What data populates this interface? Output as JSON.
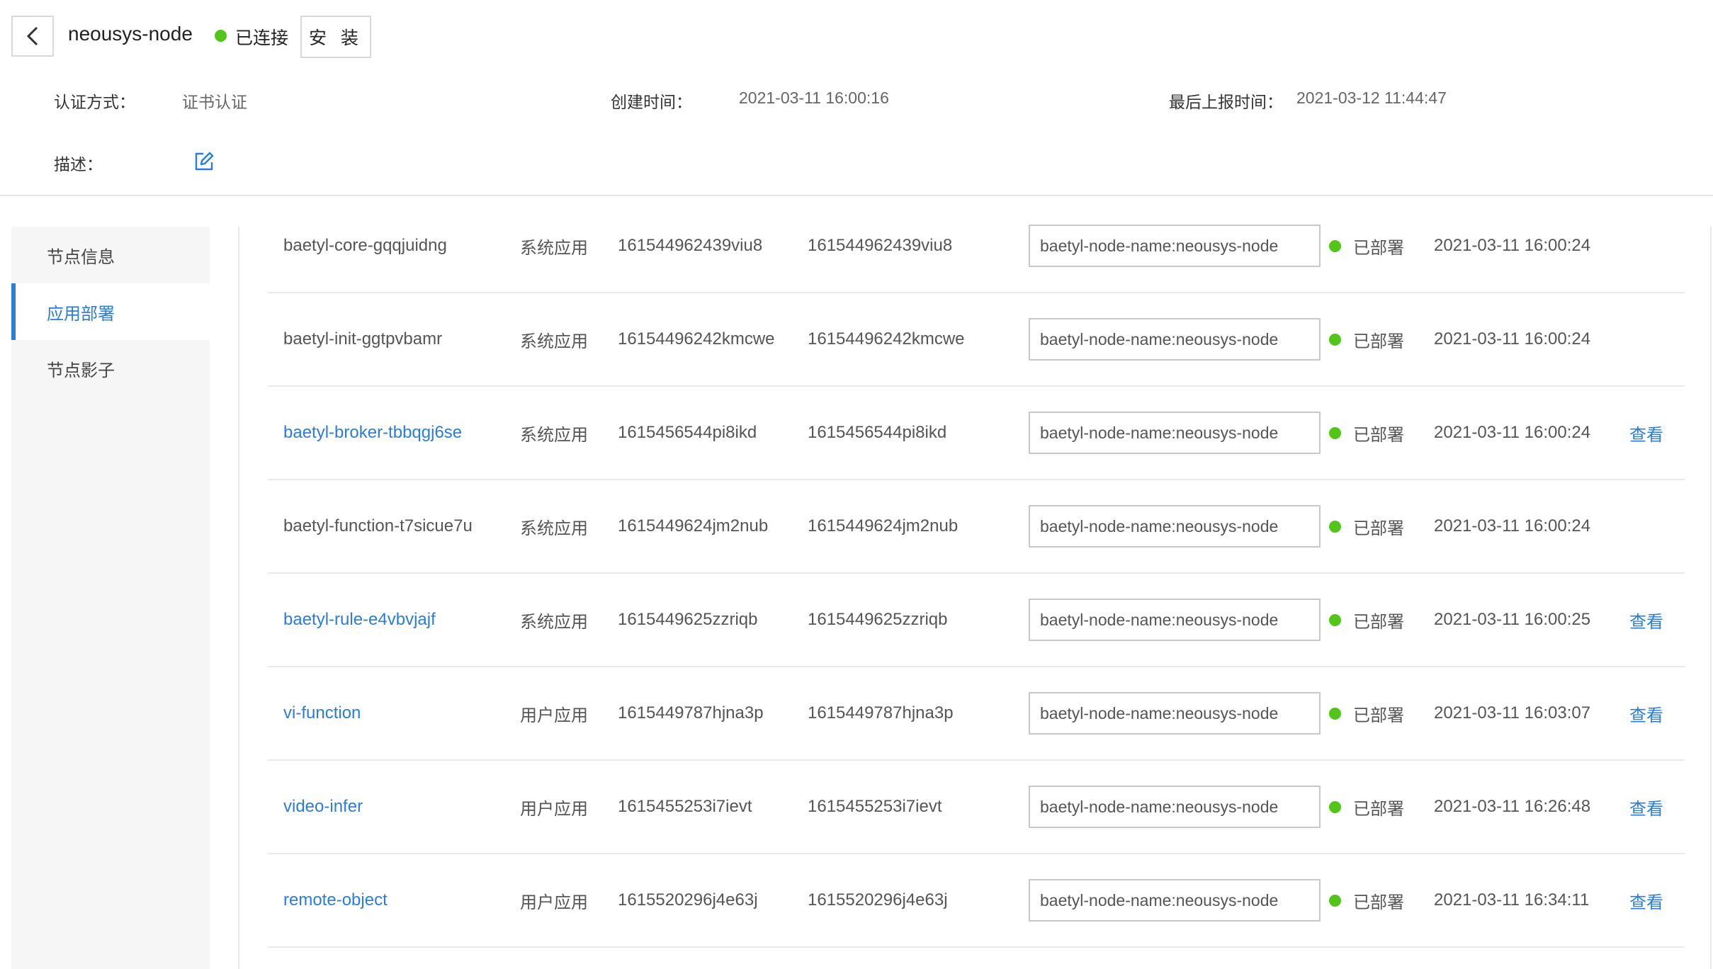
{
  "header": {
    "node_name": "neousys-node",
    "connection_status": "已连接",
    "install_label": "安 装",
    "auth_label": "认证方式：",
    "auth_value": "证书认证",
    "created_label": "创建时间：",
    "created_value": "2021-03-11 16:00:16",
    "report_label": "最后上报时间：",
    "report_value": "2021-03-12 11:44:47",
    "desc_label": "描述："
  },
  "sidebar": {
    "items": [
      {
        "label": "节点信息"
      },
      {
        "label": "应用部署"
      },
      {
        "label": "节点影子"
      }
    ]
  },
  "colors": {
    "accent": "#2a7ddc",
    "status_green": "#52c41a"
  },
  "apps": [
    {
      "name": "baetyl-core-gqqjuidng",
      "type": "系统应用",
      "version": "161544962439viu8",
      "config_version": "161544962439viu8",
      "selector": "baetyl-node-name:neousys-node",
      "status": "已部署",
      "time": "2021-03-11 16:00:24",
      "action": ""
    },
    {
      "name": "baetyl-init-ggtpvbamr",
      "type": "系统应用",
      "version": "16154496242kmcwe",
      "config_version": "16154496242kmcwe",
      "selector": "baetyl-node-name:neousys-node",
      "status": "已部署",
      "time": "2021-03-11 16:00:24",
      "action": ""
    },
    {
      "name": "baetyl-broker-tbbqgj6se",
      "type": "系统应用",
      "version": "1615456544pi8ikd",
      "config_version": "1615456544pi8ikd",
      "selector": "baetyl-node-name:neousys-node",
      "status": "已部署",
      "time": "2021-03-11 16:00:24",
      "action": "查看"
    },
    {
      "name": "baetyl-function-t7sicue7u",
      "type": "系统应用",
      "version": "1615449624jm2nub",
      "config_version": "1615449624jm2nub",
      "selector": "baetyl-node-name:neousys-node",
      "status": "已部署",
      "time": "2021-03-11 16:00:24",
      "action": ""
    },
    {
      "name": "baetyl-rule-e4vbvjajf",
      "type": "系统应用",
      "version": "1615449625zzriqb",
      "config_version": "1615449625zzriqb",
      "selector": "baetyl-node-name:neousys-node",
      "status": "已部署",
      "time": "2021-03-11 16:00:25",
      "action": "查看"
    },
    {
      "name": "vi-function",
      "type": "用户应用",
      "version": "1615449787hjna3p",
      "config_version": "1615449787hjna3p",
      "selector": "baetyl-node-name:neousys-node",
      "status": "已部署",
      "time": "2021-03-11 16:03:07",
      "action": "查看"
    },
    {
      "name": "video-infer",
      "type": "用户应用",
      "version": "1615455253i7ievt",
      "config_version": "1615455253i7ievt",
      "selector": "baetyl-node-name:neousys-node",
      "status": "已部署",
      "time": "2021-03-11 16:26:48",
      "action": "查看"
    },
    {
      "name": "remote-object",
      "type": "用户应用",
      "version": "1615520296j4e63j",
      "config_version": "1615520296j4e63j",
      "selector": "baetyl-node-name:neousys-node",
      "status": "已部署",
      "time": "2021-03-11 16:34:11",
      "action": "查看"
    }
  ]
}
